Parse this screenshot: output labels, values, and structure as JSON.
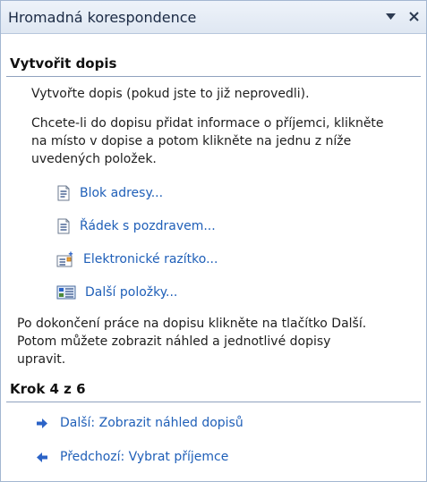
{
  "pane": {
    "title": "Hromadná korespondence",
    "menu_glyph": "▼",
    "close_glyph": "✕"
  },
  "section1": {
    "heading": "Vytvořit dopis",
    "intro": "Vytvořte dopis (pokud jste to již neprovedli).",
    "instructions_l1": "Chcete-li do dopisu přidat informace o příjemci, klikněte",
    "instructions_l2": "na místo v dopise a potom klikněte na jednu z níže",
    "instructions_l3": "uvedených položek.",
    "links": [
      {
        "label": "Blok adresy...",
        "icon": "address-block-icon"
      },
      {
        "label": "Řádek s pozdravem...",
        "icon": "greeting-line-icon"
      },
      {
        "label": "Elektronické razítko...",
        "icon": "electronic-postage-icon"
      },
      {
        "label": "Další položky...",
        "icon": "more-items-icon"
      }
    ],
    "finish_l1": "Po dokončení práce na dopisu klikněte na tlačítko Další.",
    "finish_l2": "Potom můžete zobrazit náhled a jednotlivé dopisy",
    "finish_l3": "upravit."
  },
  "section2": {
    "heading": "Krok 4 z 6",
    "next_label": "Další: Zobrazit náhled dopisů",
    "prev_label": "Předchozí: Vybrat příjemce"
  },
  "colors": {
    "link": "#1f5fb8",
    "titlebar": "#dfe7f2",
    "arrow": "#2b63c7"
  }
}
